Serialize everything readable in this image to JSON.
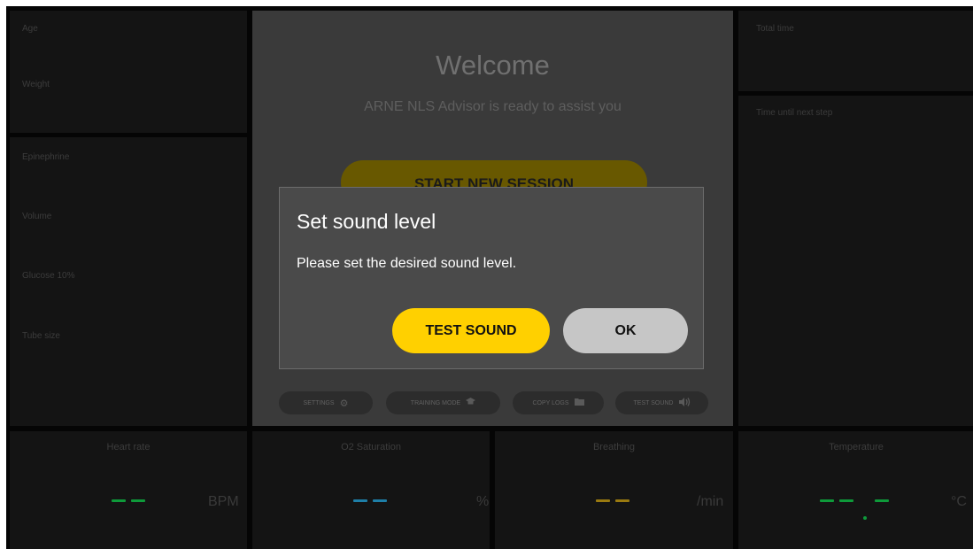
{
  "patient": {
    "age_label": "Age",
    "weight_label": "Weight"
  },
  "medication": {
    "epinephrine_label": "Epinephrine",
    "volume_label": "Volume",
    "glucose_label": "Glucose 10%",
    "tube_label": "Tube size"
  },
  "center": {
    "title": "Welcome",
    "subtitle": "ARNE NLS Advisor is ready to assist you",
    "start_button": "START NEW SESSION",
    "pills": [
      {
        "label": "SETTINGS",
        "icon": "gear-icon"
      },
      {
        "label": "TRAINING MODE",
        "icon": "graduation-cap-icon"
      },
      {
        "label": "COPY LOGS",
        "icon": "folder-icon"
      },
      {
        "label": "TEST SOUND",
        "icon": "speaker-icon"
      }
    ]
  },
  "timers": {
    "total_time_label": "Total time",
    "next_step_label": "Time until next step"
  },
  "vitals": {
    "heart_rate": {
      "label": "Heart rate",
      "unit": "BPM",
      "value": "— —",
      "color": "#0e9a3a"
    },
    "o2": {
      "label": "O2 Saturation",
      "unit": "%",
      "value": "— —",
      "color": "#1e7fa8"
    },
    "breathing": {
      "label": "Breathing",
      "unit": "/min",
      "value": "— —",
      "color": "#9a7a10"
    },
    "temperature": {
      "label": "Temperature",
      "unit": "°C",
      "value": "— — . —",
      "color": "#0e9a3a"
    }
  },
  "dialog": {
    "title": "Set sound level",
    "message": "Please set the desired sound level.",
    "test_button": "TEST SOUND",
    "ok_button": "OK"
  },
  "colors": {
    "accent": "#ffd000",
    "dialog_bg": "#4a4a4a",
    "ok_bg": "#c6c6c6"
  }
}
